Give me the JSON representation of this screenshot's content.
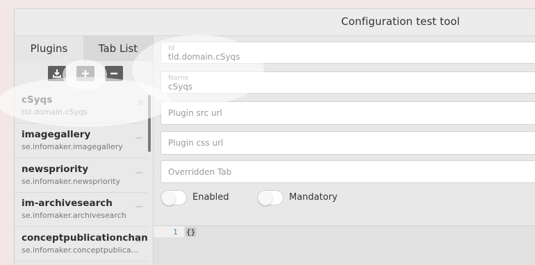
{
  "app": {
    "title": "Configuration test tool"
  },
  "tabs": [
    {
      "label": "Plugins"
    },
    {
      "label": "Tab List"
    }
  ],
  "toolbar": {
    "download_icon": "download-icon",
    "add_icon": "plus-icon",
    "remove_icon": "minus-icon"
  },
  "plugins": [
    {
      "name": "cSyqs",
      "id": "tld.domain.cSyqs",
      "action": "close-icon"
    },
    {
      "name": "imagegallery",
      "id": "se.infomaker.imagegallery",
      "action": "minus-icon"
    },
    {
      "name": "newspriority",
      "id": "se.infomaker.newspriority",
      "action": "minus-icon"
    },
    {
      "name": "im-archivesearch",
      "id": "se.infomaker.archivesearch",
      "action": "minus-icon"
    },
    {
      "name": "conceptpublicationchannel",
      "id": "se.infomaker.conceptpublica...",
      "action": "minus-icon"
    }
  ],
  "form": {
    "id": {
      "label": "Id",
      "value": "tld.domain.cSyqs"
    },
    "name": {
      "label": "Name",
      "value": "cSyqs"
    },
    "src_url": {
      "placeholder": "Plugin src url",
      "value": ""
    },
    "css_url": {
      "placeholder": "Plugin css url",
      "value": ""
    },
    "overridden_tab": {
      "placeholder": "Overridden Tab",
      "value": ""
    },
    "enabled": {
      "label": "Enabled",
      "checked": false
    },
    "mandatory": {
      "label": "Mandatory",
      "checked": false
    }
  },
  "editor": {
    "line_number": "1",
    "content": "{}"
  },
  "colors": {
    "toolbar_button": "#5f5f5f",
    "line_number": "#4a86b3",
    "highlight": "#ffffff"
  }
}
